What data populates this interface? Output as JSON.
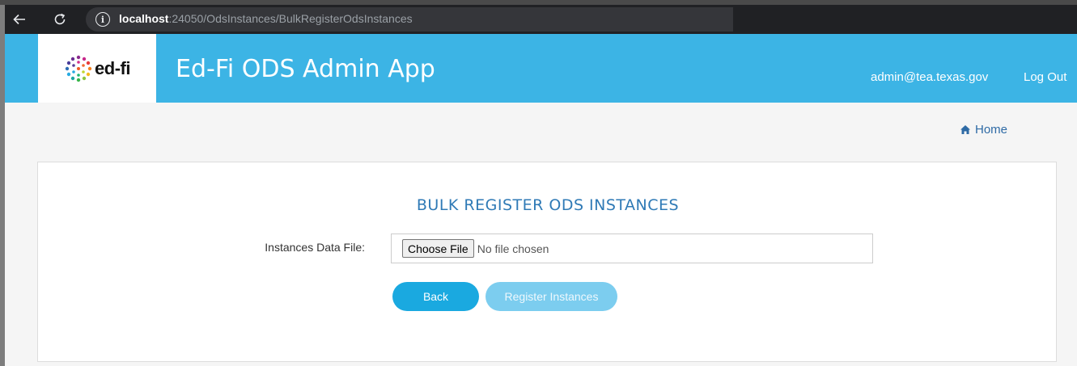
{
  "browser": {
    "url_host": "localhost",
    "url_rest": ":24050/OdsInstances/BulkRegisterOdsInstances"
  },
  "header": {
    "logo_text": "ed-fi",
    "app_title": "Ed-Fi ODS Admin App",
    "user_email": "admin@tea.texas.gov",
    "logout_label": "Log Out",
    "background_color": "#3cb4e5"
  },
  "breadcrumb": {
    "home_label": "Home",
    "icon": "home-icon"
  },
  "form": {
    "title": "BULK REGISTER ODS INSTANCES",
    "file_label": "Instances Data File:",
    "choose_file_label": "Choose File",
    "no_file_text": "No file chosen",
    "back_label": "Back",
    "register_label": "Register Instances"
  },
  "colors": {
    "primary_button": "#1aa9e0",
    "disabled_button": "#7ccdef",
    "title_color": "#2f7ab6",
    "link_color": "#2e6aa5"
  }
}
